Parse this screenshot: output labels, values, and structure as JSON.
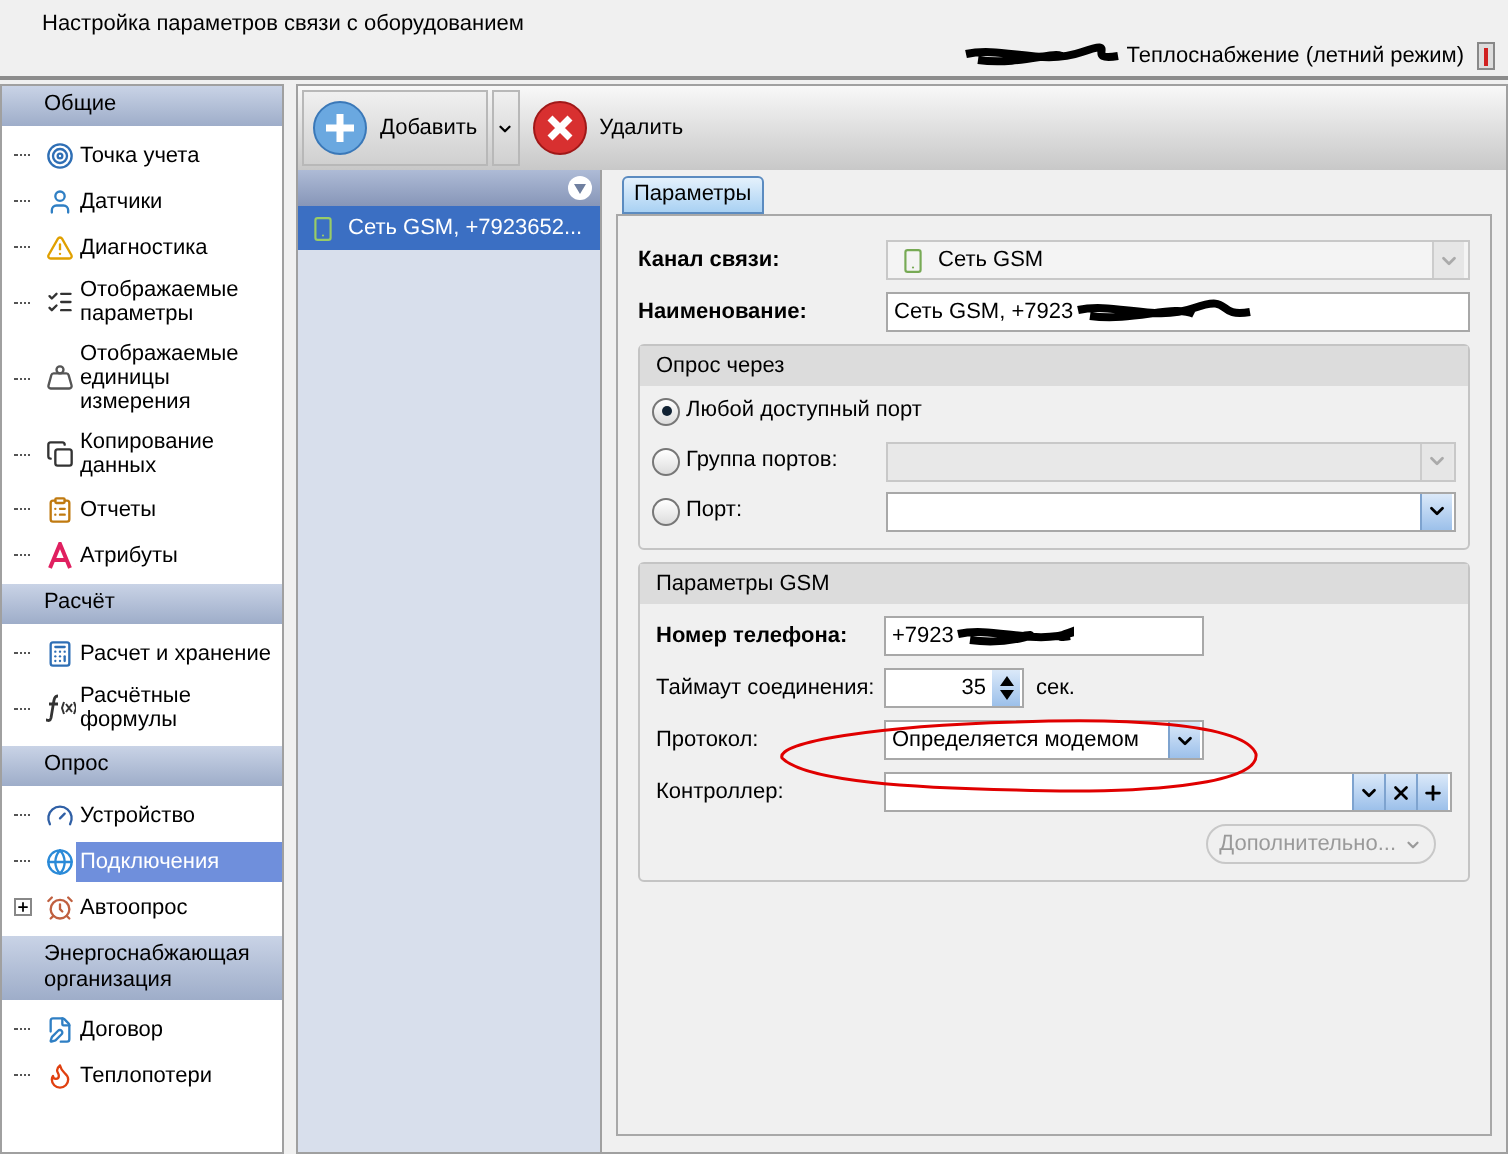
{
  "header": {
    "title": "Настройка параметров связи с оборудованием",
    "mode": "Теплоснабжение (летний режим)"
  },
  "sidebar": {
    "groups": [
      {
        "title": "Общие",
        "items": [
          {
            "label": "Точка учета",
            "kind": "target",
            "selected": false
          },
          {
            "label": "Датчики",
            "kind": "user",
            "selected": false
          },
          {
            "label": "Диагностика",
            "kind": "warning",
            "selected": false
          },
          {
            "label": "Отображаемые параметры",
            "kind": "list",
            "selected": false
          },
          {
            "label": "Отображаемые единицы измерения",
            "kind": "weight",
            "selected": false
          },
          {
            "label": "Копирование данных",
            "kind": "copy",
            "selected": false
          },
          {
            "label": "Отчеты",
            "kind": "report",
            "selected": false
          },
          {
            "label": "Атрибуты",
            "kind": "letter",
            "selected": false
          }
        ]
      },
      {
        "title": "Расчёт",
        "items": [
          {
            "label": "Расчет и хранение",
            "kind": "calc",
            "selected": false
          },
          {
            "label": "Расчётные формулы",
            "kind": "formula",
            "selected": false
          }
        ]
      },
      {
        "title": "Опрос",
        "items": [
          {
            "label": "Устройство",
            "kind": "gauge",
            "selected": false
          },
          {
            "label": "Подключения",
            "kind": "globe",
            "selected": true
          },
          {
            "label": "Автоопрос",
            "kind": "clock",
            "selected": false,
            "expanded": false
          }
        ]
      },
      {
        "title": "Энергоснабжающая организация",
        "items": [
          {
            "label": "Договор",
            "kind": "contract",
            "selected": false
          },
          {
            "label": "Теплопотери",
            "kind": "fire",
            "selected": false
          }
        ]
      }
    ]
  },
  "toolbar": [
    {
      "label": "Добавить",
      "kind": "add"
    },
    {
      "label": "Удалить",
      "kind": "delete"
    }
  ],
  "connections": [
    {
      "label": "Сеть GSM, +7923652...",
      "selected": true
    }
  ],
  "tabs": [
    {
      "label": "Параметры",
      "selected": true
    }
  ],
  "channel": {
    "label": "Канал связи:",
    "value": "Сеть GSM"
  },
  "name": {
    "label": "Наименование:",
    "value": "Сеть GSM, +7923"
  },
  "poll_via": {
    "title": "Опрос через",
    "options": [
      {
        "label": "Любой доступный порт",
        "selected": true,
        "kind": "plain"
      },
      {
        "label": "Группа портов:",
        "selected": false,
        "kind": "combo",
        "disabled": true
      },
      {
        "label": "Порт:",
        "selected": false,
        "kind": "combo",
        "disabled": false
      }
    ]
  },
  "gsm": {
    "title": "Параметры GSM",
    "phone": {
      "label": "Номер телефона:",
      "value": "+7923"
    },
    "timeout": {
      "label": "Таймаут соединения:",
      "value": "35",
      "unit": "сек."
    },
    "protocol": {
      "label": "Протокол:",
      "value": "Определяется модемом"
    },
    "controller": {
      "label": "Контроллер:"
    },
    "more": {
      "label": "Дополнительно...",
      "disabled": true
    }
  }
}
